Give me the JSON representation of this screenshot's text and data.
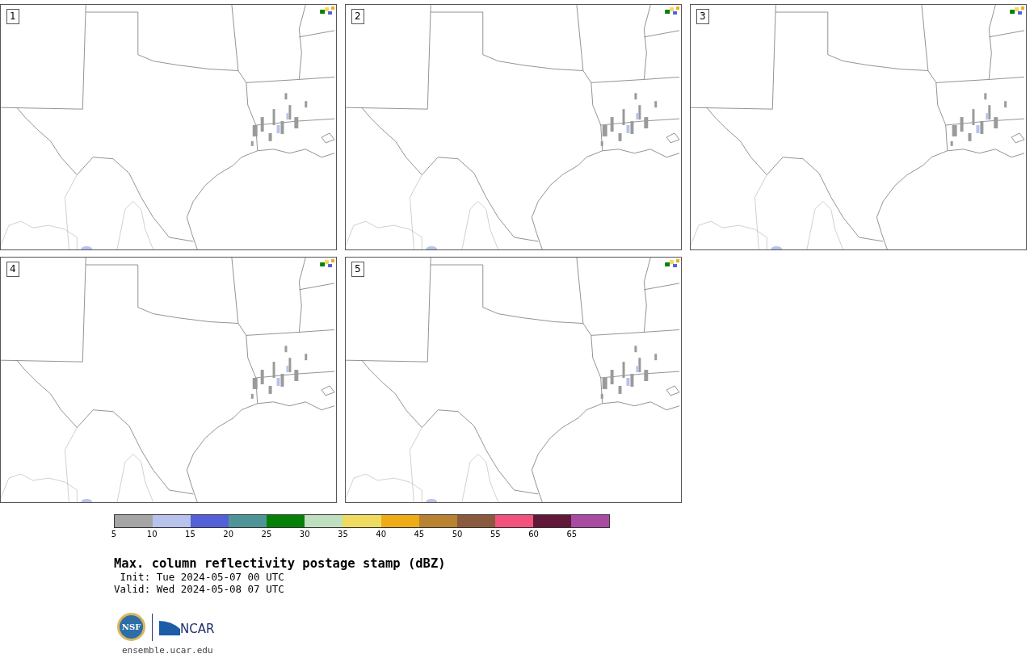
{
  "panels": [
    {
      "label": "1"
    },
    {
      "label": "2"
    },
    {
      "label": "3"
    },
    {
      "label": "4"
    },
    {
      "label": "5"
    }
  ],
  "colorbar": {
    "bins": [
      {
        "color": "#a5a5a5"
      },
      {
        "color": "#b8c2ec"
      },
      {
        "color": "#5360d8"
      },
      {
        "color": "#4f9598"
      },
      {
        "color": "#068006"
      },
      {
        "color": "#c0dfbe"
      },
      {
        "color": "#efdb5f"
      },
      {
        "color": "#efac16"
      },
      {
        "color": "#b88231"
      },
      {
        "color": "#8b5a3e"
      },
      {
        "color": "#f2527d"
      },
      {
        "color": "#621838"
      },
      {
        "color": "#aa4ba3"
      }
    ],
    "ticks": [
      "5",
      "10",
      "15",
      "20",
      "25",
      "30",
      "35",
      "40",
      "45",
      "50",
      "55",
      "60",
      "65"
    ]
  },
  "title": "Max. column reflectivity postage stamp (dBZ)",
  "init": " Init: Tue 2024-05-07 00 UTC",
  "valid": "Valid: Wed 2024-05-08 07 UTC",
  "logos": {
    "nsf": "NSF",
    "ncar": "NCAR"
  },
  "site": "ensemble.ucar.edu"
}
